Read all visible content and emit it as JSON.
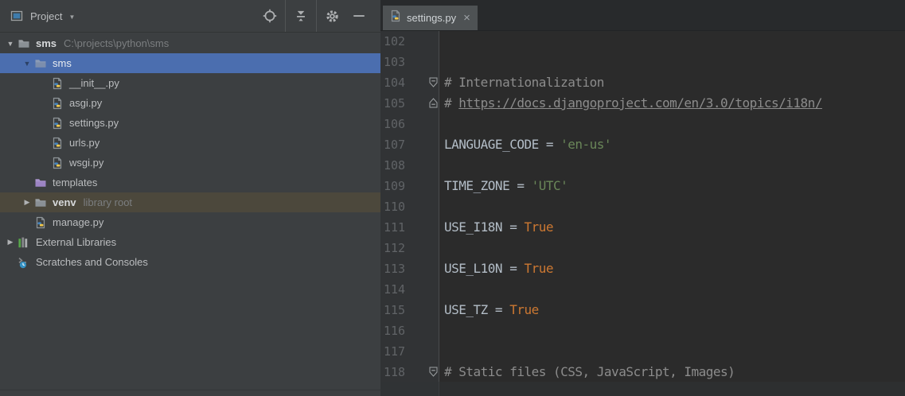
{
  "project_panel": {
    "header": {
      "title": "Project",
      "tool_icons": [
        "select-opened-file",
        "collapse-all",
        "settings",
        "hide"
      ]
    },
    "tree": [
      {
        "label": "sms",
        "secondary": "C:\\projects\\python\\sms",
        "icon": "folder",
        "arrow": "expanded",
        "level": 0,
        "bold": true
      },
      {
        "label": "sms",
        "icon": "folder-selected",
        "arrow": "expanded",
        "level": 1,
        "selected": true
      },
      {
        "label": "__init__.py",
        "icon": "python-file",
        "level": 2
      },
      {
        "label": "asgi.py",
        "icon": "python-file",
        "level": 2
      },
      {
        "label": "settings.py",
        "icon": "python-file",
        "level": 2
      },
      {
        "label": "urls.py",
        "icon": "python-file",
        "level": 2
      },
      {
        "label": "wsgi.py",
        "icon": "python-file",
        "level": 2
      },
      {
        "label": "templates",
        "icon": "folder-templates",
        "level": 1
      },
      {
        "label": "venv",
        "secondary": "library root",
        "icon": "folder",
        "arrow": "collapsed",
        "level": 1,
        "bold": true,
        "library": true
      },
      {
        "label": "manage.py",
        "icon": "python-file",
        "level": 1
      },
      {
        "label": "External Libraries",
        "icon": "external-libraries",
        "arrow": "collapsed",
        "level": 0
      },
      {
        "label": "Scratches and Consoles",
        "icon": "scratches",
        "level": 0
      }
    ]
  },
  "editor": {
    "tabs": [
      {
        "label": "settings.py",
        "icon": "python-file",
        "close_glyph": "×",
        "active": true
      }
    ],
    "first_line_number": 102,
    "lines": [
      {
        "num": "102",
        "segs": []
      },
      {
        "num": "103",
        "segs": []
      },
      {
        "num": "104",
        "fold": "top",
        "segs": [
          {
            "t": "# Internationalization",
            "c": "comment"
          }
        ]
      },
      {
        "num": "105",
        "fold": "bottom",
        "segs": [
          {
            "t": "# ",
            "c": "comment"
          },
          {
            "t": "https://docs.djangoproject.com/en/3.0/topics/i18n/",
            "c": "comment-link"
          }
        ]
      },
      {
        "num": "106",
        "segs": []
      },
      {
        "num": "107",
        "segs": [
          {
            "t": "LANGUAGE_CODE = ",
            "c": "plain"
          },
          {
            "t": "'en-us'",
            "c": "string"
          }
        ]
      },
      {
        "num": "108",
        "segs": []
      },
      {
        "num": "109",
        "segs": [
          {
            "t": "TIME_ZONE = ",
            "c": "plain"
          },
          {
            "t": "'UTC'",
            "c": "string"
          }
        ]
      },
      {
        "num": "110",
        "segs": []
      },
      {
        "num": "111",
        "segs": [
          {
            "t": "USE_I18N = ",
            "c": "plain"
          },
          {
            "t": "True",
            "c": "const"
          }
        ]
      },
      {
        "num": "112",
        "segs": []
      },
      {
        "num": "113",
        "segs": [
          {
            "t": "USE_L10N = ",
            "c": "plain"
          },
          {
            "t": "True",
            "c": "const"
          }
        ]
      },
      {
        "num": "114",
        "segs": []
      },
      {
        "num": "115",
        "segs": [
          {
            "t": "USE_TZ = ",
            "c": "plain"
          },
          {
            "t": "True",
            "c": "const"
          }
        ]
      },
      {
        "num": "116",
        "segs": []
      },
      {
        "num": "117",
        "segs": []
      },
      {
        "num": "118",
        "fold": "top",
        "segs": [
          {
            "t": "# Static files (CSS, JavaScript, Images)",
            "c": "comment"
          }
        ]
      }
    ]
  },
  "colors": {
    "panel_bg": "#3C3F41",
    "editor_bg": "#2B2B2B",
    "gutter_bg": "#313335",
    "selection_blue": "#4B6EAF",
    "library_row_olive": "#4C483C",
    "line_number": "#606366",
    "comment": "#8C8C8C",
    "plain_code": "#B3BDC7",
    "string_green": "#6A8759",
    "constant_orange": "#CC7832",
    "python_blue": "#4585BE",
    "python_yellow": "#F2C94C",
    "folder_gray": "#8A9095",
    "folder_selected": "#7C8EAD",
    "templates_folder_purple": "#9C84C4",
    "green_bars": "#57A64A",
    "icon_gray": "#AFB1B3",
    "tool_window_blue": "#3F7CAC",
    "scratches_clock_blue": "#3592C4"
  }
}
